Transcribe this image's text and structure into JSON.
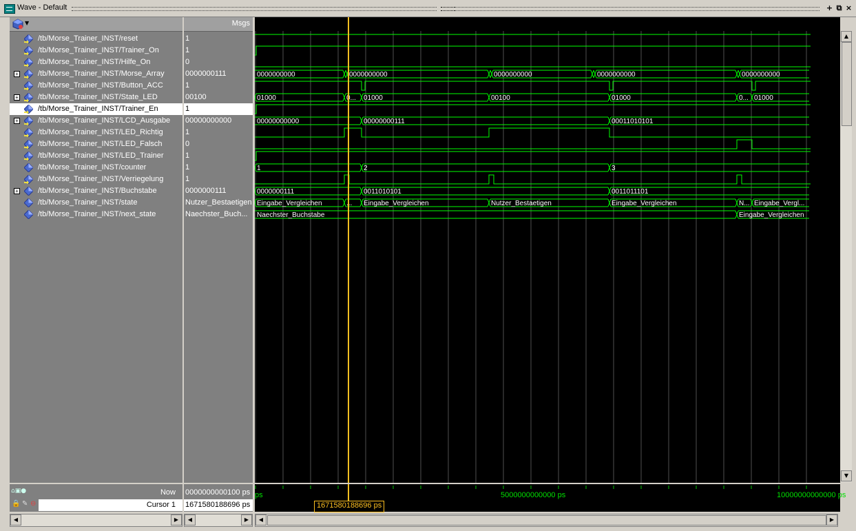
{
  "window": {
    "title": "Wave - Default"
  },
  "header": {
    "values_title": "Msgs"
  },
  "colors": {
    "wave": "#00ff00",
    "cursor": "#ffc020",
    "grid": "#505050",
    "background": "#000000"
  },
  "signals": [
    {
      "name": "/tb/Morse_Trainer_INST/reset",
      "value": "1",
      "expandable": false,
      "kind": "in"
    },
    {
      "name": "/tb/Morse_Trainer_INST/Trainer_On",
      "value": "1",
      "expandable": false,
      "kind": "in"
    },
    {
      "name": "/tb/Morse_Trainer_INST/Hilfe_On",
      "value": "0",
      "expandable": false,
      "kind": "in"
    },
    {
      "name": "/tb/Morse_Trainer_INST/Morse_Array",
      "value": "0000000111",
      "expandable": true,
      "kind": "in"
    },
    {
      "name": "/tb/Morse_Trainer_INST/Button_ACC",
      "value": "1",
      "expandable": false,
      "kind": "in"
    },
    {
      "name": "/tb/Morse_Trainer_INST/State_LED",
      "value": "00100",
      "expandable": true,
      "kind": "out"
    },
    {
      "name": "/tb/Morse_Trainer_INST/Trainer_En",
      "value": "1",
      "expandable": false,
      "kind": "out",
      "selected": true
    },
    {
      "name": "/tb/Morse_Trainer_INST/LCD_Ausgabe",
      "value": "00000000000",
      "expandable": true,
      "kind": "out"
    },
    {
      "name": "/tb/Morse_Trainer_INST/LED_Richtig",
      "value": "1",
      "expandable": false,
      "kind": "out"
    },
    {
      "name": "/tb/Morse_Trainer_INST/LED_Falsch",
      "value": "0",
      "expandable": false,
      "kind": "out"
    },
    {
      "name": "/tb/Morse_Trainer_INST/LED_Trainer",
      "value": "1",
      "expandable": false,
      "kind": "out"
    },
    {
      "name": "/tb/Morse_Trainer_INST/counter",
      "value": "1",
      "expandable": false,
      "kind": "int"
    },
    {
      "name": "/tb/Morse_Trainer_INST/Verriegelung",
      "value": "1",
      "expandable": false,
      "kind": "out"
    },
    {
      "name": "/tb/Morse_Trainer_INST/Buchstabe",
      "value": "0000000111",
      "expandable": true,
      "kind": "int"
    },
    {
      "name": "/tb/Morse_Trainer_INST/state",
      "value": "Nutzer_Bestaetigen",
      "expandable": false,
      "kind": "int"
    },
    {
      "name": "/tb/Morse_Trainer_INST/next_state",
      "value": "Naechster_Buch...",
      "expandable": false,
      "kind": "int"
    }
  ],
  "bus_labels": [
    {
      "row": 3,
      "segments": [
        "0000000000",
        "0000000000",
        "0000000000",
        "0000000000",
        "0000000000"
      ]
    },
    {
      "row": 5,
      "segments": [
        "01000",
        "0...",
        "01000",
        "00100",
        "01000",
        "0...",
        "01000"
      ]
    },
    {
      "row": 7,
      "segments": [
        "00000000000",
        "00000000111",
        "00011010101"
      ]
    },
    {
      "row": 11,
      "segments": [
        "1",
        "2",
        "3"
      ]
    },
    {
      "row": 13,
      "segments": [
        "0000000111",
        "0011010101",
        "0011011101"
      ]
    },
    {
      "row": 14,
      "segments": [
        "Eingabe_Vergleichen",
        "...",
        "Eingabe_Vergleichen",
        "Nutzer_Bestaetigen",
        "Eingabe_Vergleichen",
        "N...",
        "Eingabe_Vergl..."
      ]
    },
    {
      "row": 15,
      "segments": [
        "Naechster_Buchstabe",
        "Eingabe_Vergleichen"
      ]
    }
  ],
  "footer": {
    "now_label": "Now",
    "now_value": "0000000000100 ps",
    "cursor_label": "Cursor 1",
    "cursor_value": "1671580188696 ps",
    "cursor_flag": "1671580188696 ps",
    "axis_left": "ps",
    "axis_mid": "5000000000000 ps",
    "axis_right": "10000000000000 ps"
  }
}
